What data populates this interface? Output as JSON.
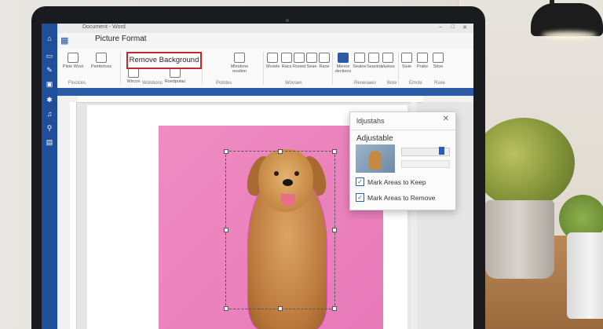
{
  "window": {
    "title": "Document - Word",
    "controls": [
      "–",
      "□",
      "✕"
    ]
  },
  "left_rail": {
    "icons": [
      "home-icon",
      "file-icon",
      "edit-icon",
      "layout-icon",
      "star-icon",
      "music-icon",
      "link-icon",
      "image-icon"
    ]
  },
  "tabs": {
    "active": "Picture Format"
  },
  "ribbon": {
    "buttons": [
      {
        "label": "Pleie Wost",
        "icon": "picture-icon"
      },
      {
        "label": "Pambrtoxs",
        "icon": "picture-icon"
      },
      {
        "label": "Wircon",
        "icon": "shape-icon"
      },
      {
        "label": "Roedpulao",
        "icon": "shape-icon"
      },
      {
        "label": "Mlmdone resdion",
        "icon": "window-icon"
      },
      {
        "label": "Mcekle",
        "icon": "style-icon"
      },
      {
        "label": "Racs",
        "icon": "style-icon"
      },
      {
        "label": "Rooed",
        "icon": "style-icon"
      },
      {
        "label": "Seae",
        "icon": "style-icon"
      },
      {
        "label": "Rane",
        "icon": "style-icon"
      },
      {
        "label": "Menoe dectieos",
        "icon": "arrange-icon"
      },
      {
        "label": "Sealoe",
        "icon": "arrange-icon"
      },
      {
        "label": "Seaoins",
        "icon": "arrange-icon"
      },
      {
        "label": "Vaskes",
        "icon": "arrange-icon"
      },
      {
        "label": "Siuie",
        "icon": "size-icon"
      },
      {
        "label": "Prake",
        "icon": "size-icon"
      },
      {
        "label": "Stioe",
        "icon": "size-icon"
      }
    ],
    "remove_background": "Remove Background",
    "groups": [
      "Flocices",
      "Wolstions",
      "Pototes",
      "Wovsen",
      "Reoeoaeo",
      "Bote",
      "Emcle",
      "Rsee"
    ]
  },
  "panel": {
    "title": "ldjustahs",
    "subtitle": "Adjustable",
    "close": "✕",
    "options": [
      {
        "label": "Mark Areas to Keep",
        "checked": true
      },
      {
        "label": "Mark Areas to Remove",
        "checked": true
      }
    ],
    "slider_level": 0.9
  },
  "colors": {
    "accent": "#1f4e9b",
    "highlight": "#c42a2a",
    "photo_background": "#ef86c0",
    "mark_outline": "#e64ad0"
  }
}
